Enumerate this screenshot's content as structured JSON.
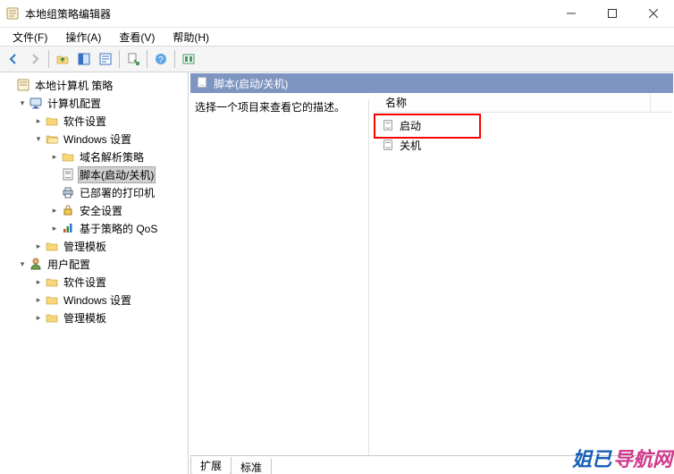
{
  "title": "本地组策略编辑器",
  "menu": {
    "file": "文件(F)",
    "action": "操作(A)",
    "view": "查看(V)",
    "help": "帮助(H)"
  },
  "tree": {
    "root": "本地计算机 策略",
    "computer": "计算机配置",
    "c_software": "软件设置",
    "c_windows": "Windows 设置",
    "c_dns": "域名解析策略",
    "c_scripts": "脚本(启动/关机)",
    "c_printers": "已部署的打印机",
    "c_security": "安全设置",
    "c_qos": "基于策略的 QoS",
    "c_admin": "管理模板",
    "user": "用户配置",
    "u_software": "软件设置",
    "u_windows": "Windows 设置",
    "u_admin": "管理模板"
  },
  "content": {
    "header": "脚本(启动/关机)",
    "prompt": "选择一个项目来查看它的描述。",
    "col_name": "名称",
    "items": {
      "startup": "启动",
      "shutdown": "关机"
    }
  },
  "tabs": {
    "extended": "扩展",
    "standard": "标准"
  },
  "watermark": {
    "a": "姐已",
    "b": "导航网"
  }
}
